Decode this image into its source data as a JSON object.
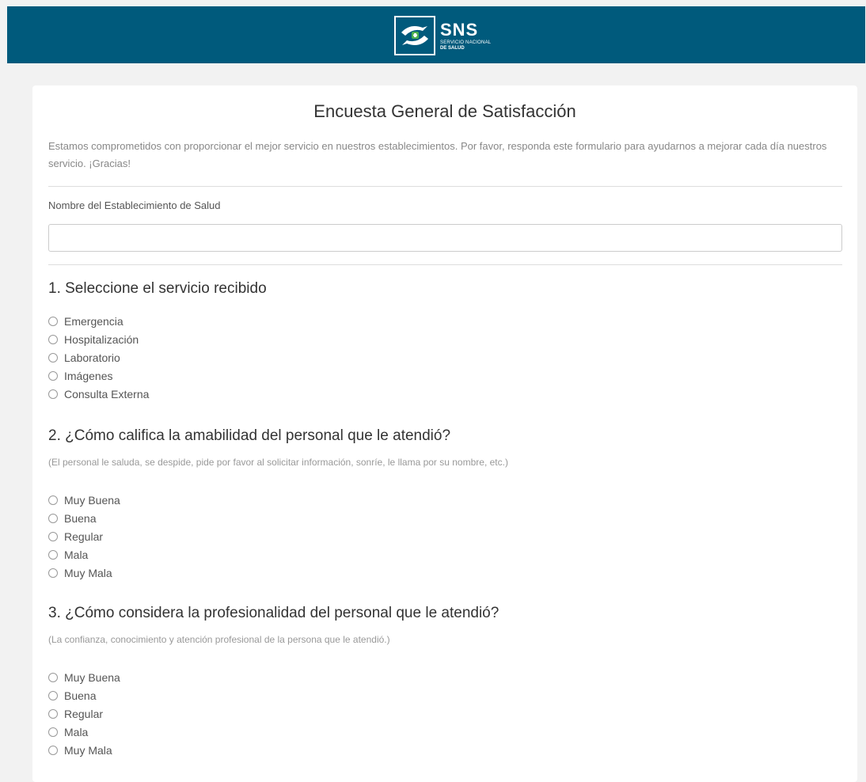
{
  "header": {
    "logo": {
      "title": "SNS",
      "subtitle1": "SERVICIO NACIONAL",
      "subtitle2": "DE SALUD"
    },
    "color": "#005a7c"
  },
  "form": {
    "title": "Encuesta General de Satisfacción",
    "intro": "Estamos comprometidos con proporcionar el mejor servicio en nuestros establecimientos. Por favor, responda este formulario para ayudarnos a mejorar cada día nuestros servicio. ¡Gracias!",
    "establishment_label": "Nombre del Establecimiento de Salud",
    "establishment_value": "",
    "questions": [
      {
        "title": "1. Seleccione el servicio recibido",
        "hint": "",
        "options": [
          "Emergencia",
          "Hospitalización",
          "Laboratorio",
          "Imágenes",
          "Consulta Externa"
        ]
      },
      {
        "title": "2. ¿Cómo califica la amabilidad del personal que le atendió?",
        "hint": "(El personal le saluda, se despide, pide por favor al solicitar información, sonríe, le llama por su nombre, etc.)",
        "options": [
          "Muy Buena",
          "Buena",
          "Regular",
          "Mala",
          "Muy Mala"
        ]
      },
      {
        "title": "3. ¿Cómo considera la profesionalidad del personal que le atendió?",
        "hint": "(La confianza, conocimiento y atención profesional de la persona que le atendió.)",
        "options": [
          "Muy Buena",
          "Buena",
          "Regular",
          "Mala",
          "Muy Mala"
        ]
      }
    ]
  }
}
